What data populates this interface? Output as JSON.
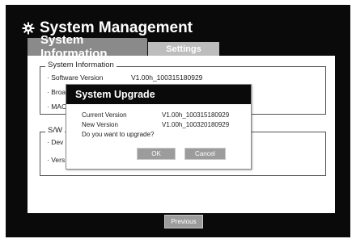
{
  "header": {
    "title": "System Management",
    "icon": "gear-icon"
  },
  "tabs": [
    {
      "label": "System Information",
      "active": true
    },
    {
      "label": "Settings",
      "active": false
    }
  ],
  "system_info": {
    "legend": "System Information",
    "rows": [
      {
        "label": "· Software Version",
        "value": "V1.00h_100315180929"
      },
      {
        "label": "· Broa",
        "value": ""
      },
      {
        "label": "· MAC",
        "value": ""
      }
    ]
  },
  "sw_info": {
    "legend": "S/W",
    "rows": [
      {
        "label": "· Dev",
        "value": ""
      },
      {
        "label": "· Vers",
        "value": ""
      }
    ]
  },
  "footer": {
    "previous_label": "Previous"
  },
  "dialog": {
    "title": "System Upgrade",
    "current_label": "Current Version",
    "current_value": "V1.00h_100315180929",
    "new_label": "New Version",
    "new_value": "V1.00h_100320180929",
    "question": "Do you want to upgrade?",
    "ok_label": "OK",
    "cancel_label": "Cancel"
  },
  "colors": {
    "frame": "#0a0a0a",
    "tab_active": "#8a8a8a",
    "tab_inactive": "#bdbdbd",
    "button": "#9c9c9c"
  }
}
